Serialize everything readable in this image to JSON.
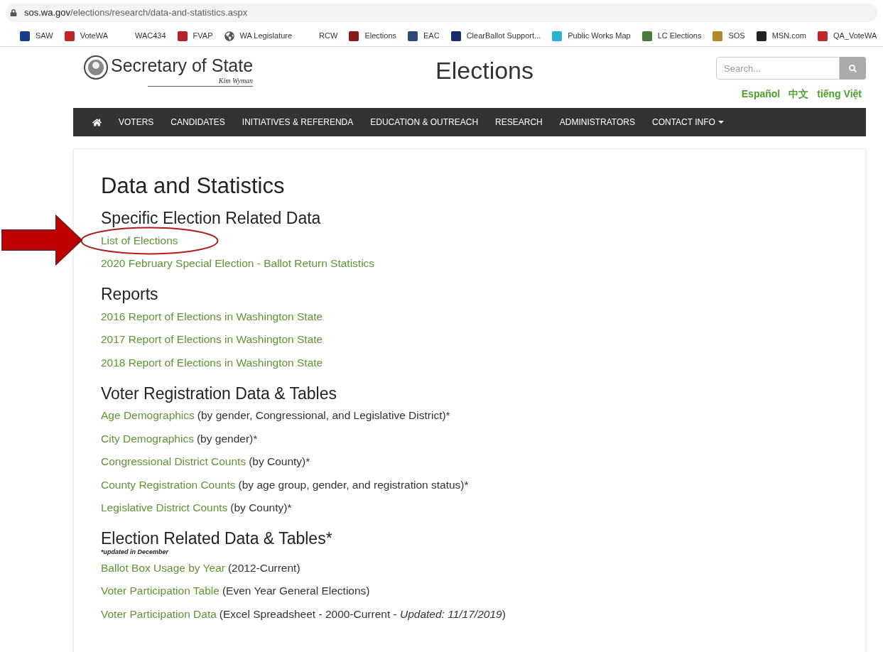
{
  "browser": {
    "url_host": "sos.wa.gov",
    "url_path": "/elections/research/data-and-statistics.aspx",
    "bookmarks": [
      {
        "label": "SAW",
        "has_icon": true
      },
      {
        "label": "VoteWA",
        "has_icon": true
      },
      {
        "label": "WAC434",
        "has_icon": false
      },
      {
        "label": "FVAP",
        "has_icon": true
      },
      {
        "label": "WA Legislature",
        "has_icon": true
      },
      {
        "label": "RCW",
        "has_icon": false
      },
      {
        "label": "Elections",
        "has_icon": true
      },
      {
        "label": "EAC",
        "has_icon": true
      },
      {
        "label": "ClearBallot Support...",
        "has_icon": true
      },
      {
        "label": "Public Works Map",
        "has_icon": true
      },
      {
        "label": "LC Elections",
        "has_icon": true
      },
      {
        "label": "SOS",
        "has_icon": true
      },
      {
        "label": "MSN.com",
        "has_icon": true
      },
      {
        "label": "QA_VoteWA",
        "has_icon": true
      }
    ]
  },
  "header": {
    "logo_text": "Secretary of State",
    "logo_signature": "Kim Wyman",
    "title": "Elections",
    "search": {
      "placeholder": "Search..."
    },
    "languages": [
      "Español",
      "中文",
      "tiếng Việt"
    ]
  },
  "nav": [
    {
      "label": "VOTERS",
      "dropdown": false
    },
    {
      "label": "CANDIDATES",
      "dropdown": false
    },
    {
      "label": "INITIATIVES & REFERENDA",
      "dropdown": false
    },
    {
      "label": "EDUCATION & OUTREACH",
      "dropdown": false
    },
    {
      "label": "RESEARCH",
      "dropdown": false
    },
    {
      "label": "ADMINISTRATORS",
      "dropdown": false
    },
    {
      "label": "CONTACT INFO",
      "dropdown": true
    }
  ],
  "page": {
    "title": "Data and Statistics",
    "sections": [
      {
        "heading": "Specific Election Related Data",
        "items": [
          {
            "link": "List of Elections",
            "annotated": true
          },
          {
            "link": "2020 February Special Election - Ballot Return Statistics",
            "annotated": false
          }
        ]
      },
      {
        "heading": "Reports",
        "items": [
          {
            "link": "2016 Report of Elections in Washington State",
            "annotated": false
          },
          {
            "link": "2017 Report of Elections in Washington State",
            "annotated": false
          },
          {
            "link": "2018 Report of Elections in Washington State",
            "annotated": false
          }
        ]
      },
      {
        "heading": "Voter Registration Data & Tables",
        "items": [
          {
            "link": "Age Demographics",
            "rest": "(by gender, Congressional, and Legislative District)*",
            "annotated": false
          },
          {
            "link": "City Demographics",
            "rest": "(by gender)*",
            "annotated": false
          },
          {
            "link": "Congressional District Counts",
            "rest": "(by County)*",
            "annotated": false
          },
          {
            "link": "County Registration Counts",
            "rest": "(by age group, gender, and registration status)*",
            "annotated": false
          },
          {
            "link": "Legislative District Counts",
            "rest": "(by County)*",
            "annotated": false
          }
        ]
      },
      {
        "heading": "Election Related Data & Tables*",
        "note": "*updated in December",
        "items": [
          {
            "link": "Ballot Box Usage by Year",
            "rest": "(2012-Current)",
            "annotated": false
          },
          {
            "link": "Voter Participation Table",
            "rest": "(Even Year General Elections)",
            "annotated": false
          },
          {
            "link": "Voter Participation Data",
            "rest": "(Excel Spreadsheet - 2000-Current - *Updated: 11/17/2019*)",
            "annotated": false
          }
        ]
      }
    ]
  }
}
